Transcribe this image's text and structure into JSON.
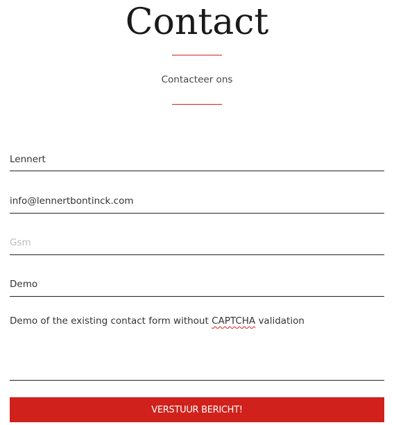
{
  "header": {
    "title": "Contact",
    "subtitle": "Contacteer ons",
    "accent_color": "#d0211c"
  },
  "form": {
    "name": {
      "value": "Lennert"
    },
    "email": {
      "value": "info@lennertbontinck.com"
    },
    "phone": {
      "placeholder": "Gsm"
    },
    "subject": {
      "value": "Demo"
    },
    "message": {
      "before": "Demo of the existing contact form without ",
      "misspelled": "CAPTCHA",
      "after": " validation"
    },
    "submit_label": "VERSTUUR BERICHT!"
  }
}
